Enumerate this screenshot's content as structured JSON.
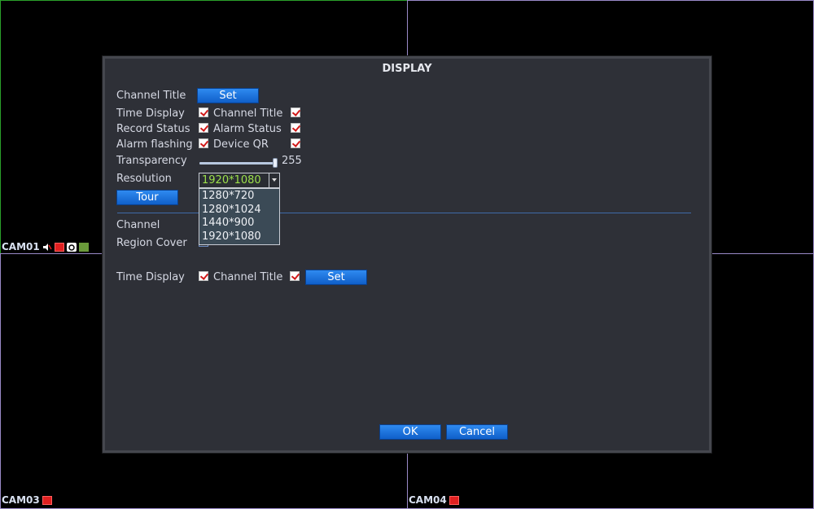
{
  "cameras": [
    {
      "label": "CAM01",
      "icons": [
        "speaker-muted-icon",
        "record-icon",
        "snapshot-icon",
        "hdd-icon"
      ]
    },
    {
      "label": "CAM03",
      "icons": [
        "record-icon"
      ]
    },
    {
      "label": "CAM04",
      "icons": [
        "record-icon"
      ]
    }
  ],
  "dialog": {
    "title": "DISPLAY",
    "channel_title_label": "Channel Title",
    "set_label": "Set",
    "time_display_label": "Time Display",
    "channel_title_check_label": "Channel Title",
    "record_status_label": "Record Status",
    "alarm_status_label": "Alarm Status",
    "alarm_flashing_label": "Alarm flashing",
    "device_qr_label": "Device QR",
    "transparency_label": "Transparency",
    "transparency_value": "255",
    "transparency_fraction": 1.0,
    "resolution_label": "Resolution",
    "resolution_value": "1920*1080",
    "resolution_options": [
      "1280*720",
      "1280*1024",
      "1440*900",
      "1920*1080"
    ],
    "tour_label": "Tour",
    "channel_label": "Channel",
    "region_cover_label": "Region Cover",
    "time_display_label_2": "Time Display",
    "channel_title_label_2": "Channel Title",
    "set_label_2": "Set",
    "ok_label": "OK",
    "cancel_label": "Cancel"
  },
  "colors": {
    "dialog_bg": "#2e3037",
    "button_blue": "#1a6fdc",
    "selected_text": "#9ce04a",
    "grid_green": "#2aa02a",
    "grid_purple": "#9a8ac8"
  }
}
